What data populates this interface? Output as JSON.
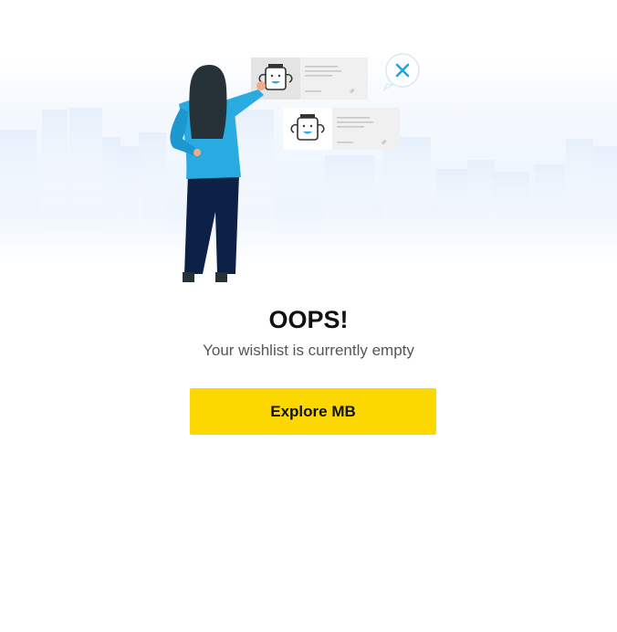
{
  "empty_state": {
    "heading": "OOPS!",
    "message": "Your wishlist is currently empty",
    "cta_label": "Explore MB"
  },
  "colors": {
    "accent": "#fdd800",
    "close_icon": "#1ca6d9",
    "figure_jacket": "#29abe2",
    "figure_pants": "#0d2147"
  }
}
